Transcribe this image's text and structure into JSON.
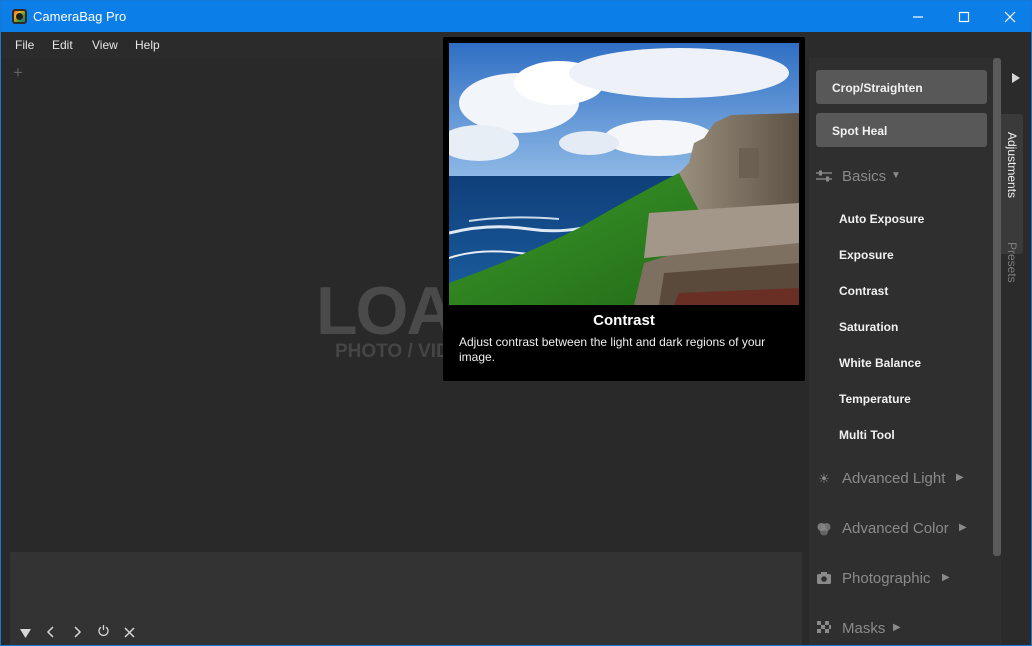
{
  "window": {
    "title": "CameraBag Pro"
  },
  "menu": [
    "File",
    "Edit",
    "View",
    "Help"
  ],
  "workspace": {
    "add_label": "+",
    "watermark": "LOA",
    "watermark_sub": "PHOTO / VID"
  },
  "tooltip": {
    "title": "Contrast",
    "description": "Adjust contrast between the light and dark regions of your image."
  },
  "panel": {
    "tools": [
      "Crop/Straighten",
      "Spot Heal"
    ],
    "basics_label": "Basics",
    "basics_items": [
      "Auto Exposure",
      "Exposure",
      "Contrast",
      "Saturation",
      "White Balance",
      "Temperature",
      "Multi Tool"
    ],
    "sections": [
      "Advanced Light",
      "Advanced Color",
      "Photographic",
      "Masks"
    ]
  },
  "sidetabs": {
    "adjustments": "Adjustments",
    "presets": "Presets"
  },
  "colors": {
    "titlebar": "#0c7ee8",
    "panel": "#2f2f2f",
    "tool_button": "#585858",
    "workspace": "#292929"
  }
}
